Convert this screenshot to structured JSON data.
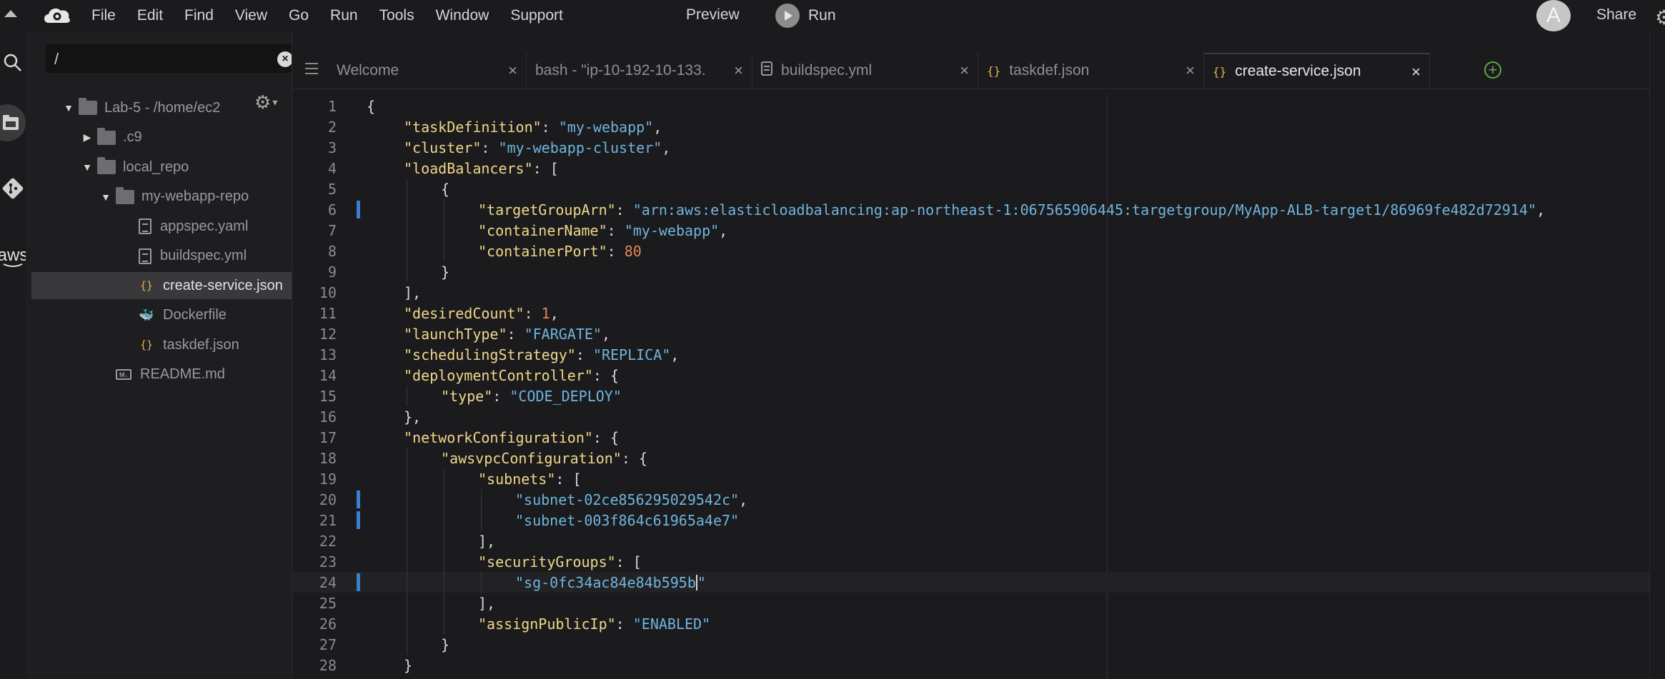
{
  "menubar": {
    "items": [
      "File",
      "Edit",
      "Find",
      "View",
      "Go",
      "Run",
      "Tools",
      "Window",
      "Support"
    ],
    "preview": "Preview",
    "run": "Run",
    "avatar_letter": "A",
    "share": "Share"
  },
  "activity": {
    "aws_label": "aws"
  },
  "sidebar": {
    "search_value": "/",
    "tree": [
      {
        "label": "Lab-5 - /home/ec2",
        "type": "folder",
        "depth": 0,
        "expanded": true
      },
      {
        "label": ".c9",
        "type": "folder",
        "depth": 1,
        "expanded": false
      },
      {
        "label": "local_repo",
        "type": "folder",
        "depth": 1,
        "expanded": true
      },
      {
        "label": "my-webapp-repo",
        "type": "folder",
        "depth": 2,
        "expanded": true
      },
      {
        "label": "appspec.yaml",
        "type": "file",
        "depth": 3
      },
      {
        "label": "buildspec.yml",
        "type": "file",
        "depth": 3
      },
      {
        "label": "create-service.json",
        "type": "json",
        "depth": 3,
        "selected": true
      },
      {
        "label": "Dockerfile",
        "type": "docker",
        "depth": 3
      },
      {
        "label": "taskdef.json",
        "type": "json",
        "depth": 3
      },
      {
        "label": "README.md",
        "type": "md",
        "depth": 2
      }
    ]
  },
  "tabs": [
    {
      "label": "Welcome",
      "icon": "none"
    },
    {
      "label": "bash - \"ip-10-192-10-133.",
      "icon": "none"
    },
    {
      "label": "buildspec.yml",
      "icon": "file-icon"
    },
    {
      "label": "taskdef.json",
      "icon": "json-icon"
    },
    {
      "label": "create-service.json",
      "icon": "json-icon",
      "active": true
    }
  ],
  "editor": {
    "lines": [
      {
        "indent": 0,
        "parts": [
          [
            "p",
            "{"
          ]
        ]
      },
      {
        "indent": 1,
        "parts": [
          [
            "k",
            "\"taskDefinition\""
          ],
          [
            "p",
            ": "
          ],
          [
            "s",
            "\"my-webapp\""
          ],
          [
            "p",
            ","
          ]
        ]
      },
      {
        "indent": 1,
        "parts": [
          [
            "k",
            "\"cluster\""
          ],
          [
            "p",
            ": "
          ],
          [
            "s",
            "\"my-webapp-cluster\""
          ],
          [
            "p",
            ","
          ]
        ]
      },
      {
        "indent": 1,
        "parts": [
          [
            "k",
            "\"loadBalancers\""
          ],
          [
            "p",
            ": ["
          ]
        ]
      },
      {
        "indent": 2,
        "parts": [
          [
            "p",
            "{"
          ]
        ]
      },
      {
        "indent": 3,
        "marker": true,
        "parts": [
          [
            "k",
            "\"targetGroupArn\""
          ],
          [
            "p",
            ": "
          ],
          [
            "s",
            "\"arn:aws:elasticloadbalancing:ap-northeast-1:067565906445:targetgroup/MyApp-ALB-target1/86969fe482d72914\""
          ],
          [
            "p",
            ","
          ]
        ]
      },
      {
        "indent": 3,
        "parts": [
          [
            "k",
            "\"containerName\""
          ],
          [
            "p",
            ": "
          ],
          [
            "s",
            "\"my-webapp\""
          ],
          [
            "p",
            ","
          ]
        ]
      },
      {
        "indent": 3,
        "parts": [
          [
            "k",
            "\"containerPort\""
          ],
          [
            "p",
            ": "
          ],
          [
            "n",
            "80"
          ]
        ]
      },
      {
        "indent": 2,
        "parts": [
          [
            "p",
            "}"
          ]
        ]
      },
      {
        "indent": 1,
        "parts": [
          [
            "p",
            "],"
          ]
        ]
      },
      {
        "indent": 1,
        "parts": [
          [
            "k",
            "\"desiredCount\""
          ],
          [
            "p",
            ": "
          ],
          [
            "n",
            "1"
          ],
          [
            "p",
            ","
          ]
        ]
      },
      {
        "indent": 1,
        "parts": [
          [
            "k",
            "\"launchType\""
          ],
          [
            "p",
            ": "
          ],
          [
            "s",
            "\"FARGATE\""
          ],
          [
            "p",
            ","
          ]
        ]
      },
      {
        "indent": 1,
        "parts": [
          [
            "k",
            "\"schedulingStrategy\""
          ],
          [
            "p",
            ": "
          ],
          [
            "s",
            "\"REPLICA\""
          ],
          [
            "p",
            ","
          ]
        ]
      },
      {
        "indent": 1,
        "parts": [
          [
            "k",
            "\"deploymentController\""
          ],
          [
            "p",
            ": {"
          ]
        ]
      },
      {
        "indent": 2,
        "parts": [
          [
            "k",
            "\"type\""
          ],
          [
            "p",
            ": "
          ],
          [
            "s",
            "\"CODE_DEPLOY\""
          ]
        ]
      },
      {
        "indent": 1,
        "parts": [
          [
            "p",
            "},"
          ]
        ]
      },
      {
        "indent": 1,
        "parts": [
          [
            "k",
            "\"networkConfiguration\""
          ],
          [
            "p",
            ": {"
          ]
        ]
      },
      {
        "indent": 2,
        "parts": [
          [
            "k",
            "\"awsvpcConfiguration\""
          ],
          [
            "p",
            ": {"
          ]
        ]
      },
      {
        "indent": 3,
        "parts": [
          [
            "k",
            "\"subnets\""
          ],
          [
            "p",
            ": ["
          ]
        ]
      },
      {
        "indent": 4,
        "marker": true,
        "parts": [
          [
            "s",
            "\"subnet-02ce856295029542c\""
          ],
          [
            "p",
            ","
          ]
        ]
      },
      {
        "indent": 4,
        "marker": true,
        "parts": [
          [
            "s",
            "\"subnet-003f864c61965a4e7\""
          ]
        ]
      },
      {
        "indent": 3,
        "parts": [
          [
            "p",
            "],"
          ]
        ]
      },
      {
        "indent": 3,
        "parts": [
          [
            "k",
            "\"securityGroups\""
          ],
          [
            "p",
            ": ["
          ]
        ]
      },
      {
        "indent": 4,
        "marker": true,
        "current": true,
        "cursor_after": "\"sg-0fc34ac84e84b595b",
        "parts": [
          [
            "s",
            "\"sg-0fc34ac84e84b595b"
          ],
          [
            "cursor",
            ""
          ],
          [
            "s",
            "\""
          ]
        ]
      },
      {
        "indent": 3,
        "parts": [
          [
            "p",
            "],"
          ]
        ]
      },
      {
        "indent": 3,
        "parts": [
          [
            "k",
            "\"assignPublicIp\""
          ],
          [
            "p",
            ": "
          ],
          [
            "s",
            "\"ENABLED\""
          ]
        ]
      },
      {
        "indent": 2,
        "parts": [
          [
            "p",
            "}"
          ]
        ]
      },
      {
        "indent": 1,
        "parts": [
          [
            "p",
            "}"
          ]
        ]
      }
    ]
  },
  "colors": {
    "background": "#1b1b1d",
    "key": "#f0d78a",
    "string": "#6fb4df",
    "number": "#e0875c",
    "marker": "#3b7ed0",
    "json_icon": "#e2b04a",
    "add_tab": "#5fa84a"
  }
}
